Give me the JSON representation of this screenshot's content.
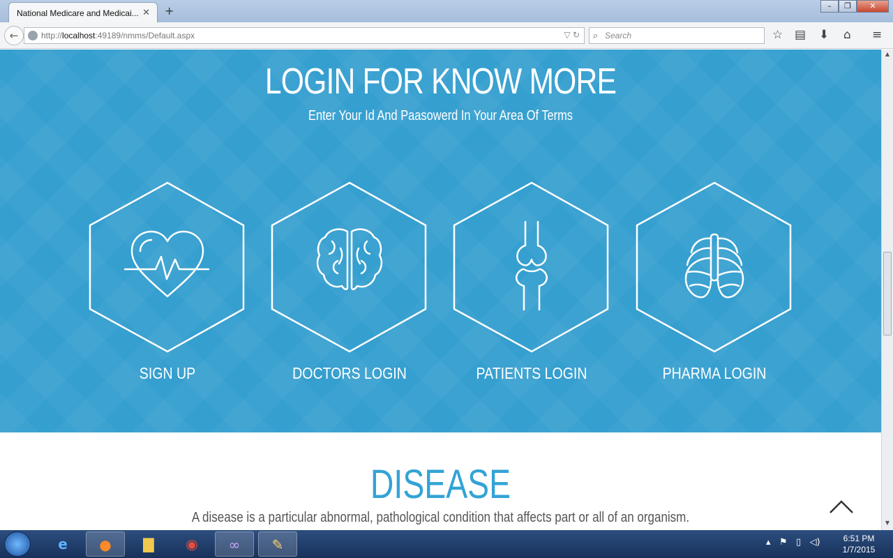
{
  "browser": {
    "tab_title": "National Medicare and Medicai...",
    "tab_close": "✕",
    "new_tab": "+",
    "url_prefix": "http://",
    "url_host": "localhost",
    "url_rest": ":49189/nmms/Default.aspx",
    "search_placeholder": "Search",
    "window_buttons": {
      "minimize": "–",
      "maximize": "❐",
      "close": "✕"
    }
  },
  "hero": {
    "title": "LOGIN FOR KNOW MORE",
    "subtitle": "Enter Your Id And Paasowerd In Your Area Of Terms",
    "cards": [
      {
        "label": "SIGN UP",
        "icon": "heartbeat-icon"
      },
      {
        "label": "DOCTORS LOGIN",
        "icon": "brain-icon"
      },
      {
        "label": "PATIENTS LOGIN",
        "icon": "knee-joint-icon"
      },
      {
        "label": "PHARMA LOGIN",
        "icon": "rib-cage-icon"
      }
    ]
  },
  "disease": {
    "title": "DISEASE",
    "text": "A disease is a particular abnormal, pathological condition that affects part or all of an organism."
  },
  "taskbar": {
    "time": "6:51 PM",
    "date": "1/7/2015"
  },
  "colors": {
    "hero_bg": "#359fcf",
    "accent": "#33a3d6",
    "white": "#ffffff"
  }
}
